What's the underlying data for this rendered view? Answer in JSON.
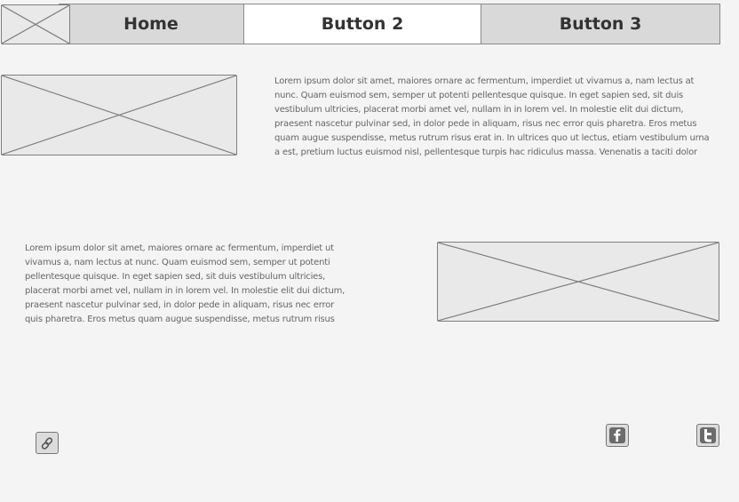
{
  "nav": {
    "logo_icon": "image-placeholder-icon",
    "buttons": [
      {
        "label": "Home"
      },
      {
        "label": "Button 2"
      },
      {
        "label": "Button 3"
      }
    ],
    "active_index": 1
  },
  "section_1": {
    "image_icon": "image-placeholder-icon",
    "text": "Lorem ipsum dolor sit amet, maiores ornare ac fermentum, imperdiet ut vivamus a, nam lectus at nunc. Quam euismod sem, semper ut potenti pellentesque quisque. In eget sapien sed, sit duis vestibulum ultricies, placerat morbi amet vel, nullam in in lorem vel. In molestie elit dui dictum, praesent nascetur pulvinar sed, in dolor pede in aliquam, risus nec error quis pharetra. Eros metus quam augue suspendisse, metus rutrum risus erat in.  In ultrices quo ut lectus, etiam vestibulum urna a est, pretium luctus euismod nisl, pellentesque turpis hac ridiculus massa. Venenatis a taciti dolor platea, curabitur"
  },
  "section_2": {
    "image_icon": "image-placeholder-icon",
    "text": "Lorem ipsum dolor sit amet, maiores ornare ac fermentum, imperdiet ut vivamus a, nam lectus at nunc. Quam euismod sem, semper ut potenti pellentesque quisque. In eget sapien sed, sit duis vestibulum ultricies, placerat morbi amet vel, nullam in in lorem vel. In molestie elit dui dictum, praesent nascetur pulvinar sed, in dolor pede in aliquam, risus nec error quis pharetra. Eros metus quam augue suspendisse, metus rutrum risus erat in."
  },
  "footer": {
    "icons": [
      "link-icon",
      "facebook-icon",
      "twitter-icon"
    ]
  },
  "colors": {
    "background": "#f4f4f4",
    "nav_inactive": "#d9d9d9",
    "nav_active": "#ffffff",
    "border": "#7f7f7f",
    "body_text": "#666666"
  }
}
